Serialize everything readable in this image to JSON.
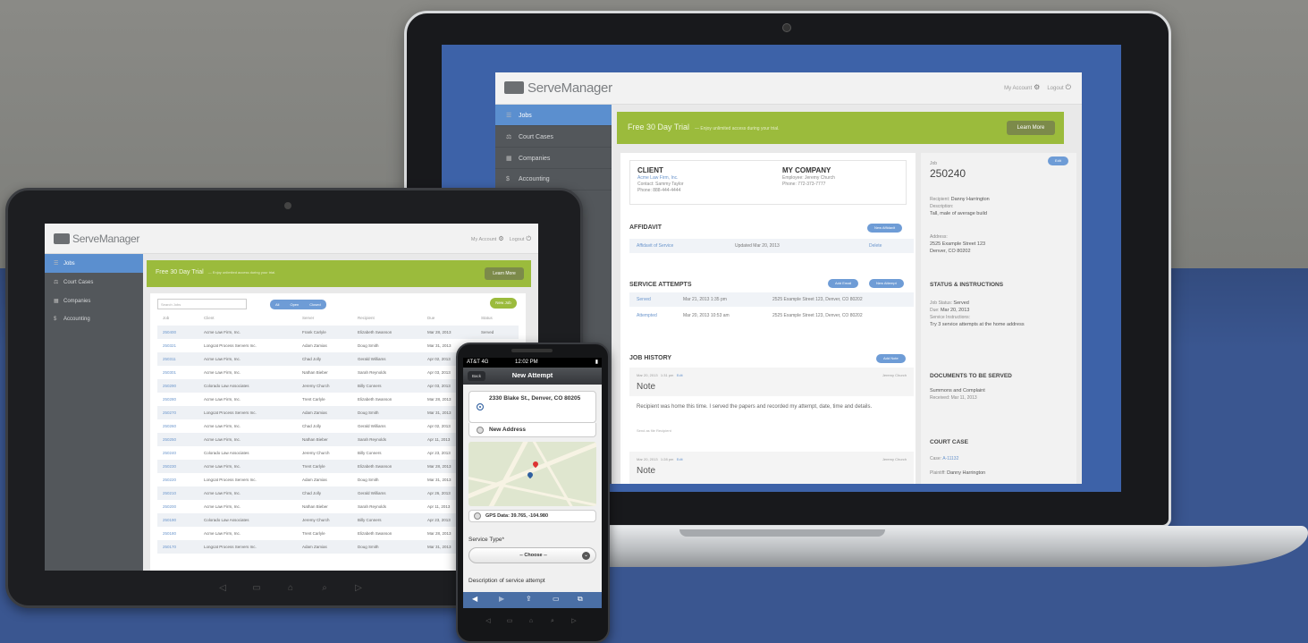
{
  "colors": {
    "accent_blue": "#5b8fcf",
    "trial_green": "#9bbb3c",
    "sidebar": "#53575b",
    "background_blue": "#3a5690"
  },
  "laptop": {
    "logo": "ServeManager",
    "topnav": {
      "account": "My Account",
      "logout": "Logout"
    },
    "sidebar": [
      {
        "label": "Jobs",
        "icon": "jobs-icon"
      },
      {
        "label": "Court Cases",
        "icon": "court-icon"
      },
      {
        "label": "Companies",
        "icon": "companies-icon"
      },
      {
        "label": "Accounting",
        "icon": "accounting-icon"
      }
    ],
    "trial": {
      "title": "Free 30 Day Trial",
      "subtitle": "— Enjoy unlimited access during your trial.",
      "button": "Learn More"
    },
    "client": {
      "heading": "CLIENT",
      "name": "Acme Law Firm, Inc.",
      "contact": "Contact: Sammy Taylor",
      "phone": "Phone: 888-444-4444"
    },
    "company": {
      "heading": "MY COMPANY",
      "employee": "Employee: Jeremy Church",
      "phone": "Phone: 772-373-7777"
    },
    "affidavit": {
      "heading": "AFFIDAVIT",
      "button": "New Affidavit",
      "link": "Affidavit of Service",
      "updated": "Updated Mar 20, 2013",
      "action": "Delete"
    },
    "attempts": {
      "heading": "SERVICE ATTEMPTS",
      "buttons": [
        "Add Email",
        "New Attempt"
      ],
      "rows": [
        {
          "status": "Served",
          "date": "Mar 21, 2013 1:35 pm",
          "address": "2525 Example Street 123, Denver, CO 80202"
        },
        {
          "status": "Attempted",
          "date": "Mar 20, 2013 10:53 am",
          "address": "2525 Example Street 123, Denver, CO 80202"
        }
      ]
    },
    "history": {
      "heading": "JOB HISTORY",
      "button": "Add Note",
      "items": [
        {
          "date": "Mar 20, 2013",
          "time": "1:31 pm",
          "edit": "Edit",
          "author": "Jeremy Church",
          "type": "Note",
          "body": "Recipient was home this time. I served the papers and recorded my attempt, date, time and details.",
          "footer": "Send as file Recipient"
        },
        {
          "date": "Mar 20, 2013",
          "time": "1:28 pm",
          "edit": "Edit",
          "author": "Jeremy Church",
          "type": "Note"
        }
      ]
    },
    "job": {
      "label": "Job",
      "number": "250240",
      "edit": "Edit",
      "recipient_label": "Recipient:",
      "recipient": "Danny Harrington",
      "description_label": "Description:",
      "description": "Tall, male of average build",
      "address_label": "Address:",
      "address_line1": "2525 Example Street 123",
      "address_line2": "Denver, CO 80202",
      "status_heading": "STATUS & INSTRUCTIONS",
      "job_status_label": "Job Status:",
      "job_status": "Served",
      "due_label": "Due:",
      "due": "Mar 20, 2013",
      "instructions_label": "Service Instructions:",
      "instructions": "Try 3 service attempts at the home address",
      "documents_heading": "DOCUMENTS TO BE SERVED",
      "document": "Summons and Complaint",
      "received": "Received: Mar 11, 2013",
      "court_heading": "COURT CASE",
      "case_label": "Case:",
      "case_id": "A-11132",
      "plaintiff_label": "Plaintiff:",
      "plaintiff": "Danny Harrington"
    }
  },
  "tablet": {
    "logo": "ServeManager",
    "topnav": {
      "account": "My Account",
      "logout": "Logout"
    },
    "sidebar": [
      "Jobs",
      "Court Cases",
      "Companies",
      "Accounting"
    ],
    "trial": {
      "title": "Free 30 Day Trial",
      "subtitle": "— Enjoy unlimited access during your trial.",
      "button": "Learn More"
    },
    "search_placeholder": "Search Jobs",
    "filters": [
      "All",
      "Open",
      "Closed"
    ],
    "new_button": "New Job",
    "columns": [
      "Job",
      "Client",
      "Server",
      "Recipient",
      "Due",
      "Status"
    ],
    "rows": [
      [
        "250400",
        "Acme Law Firm, Inc.",
        "Frank Carlyle",
        "Elizabeth Swanson",
        "Mar 28, 2013",
        "Served"
      ],
      [
        "250321",
        "Longcat Process Servers Inc.",
        "Adam Zamias",
        "Doug Smith",
        "Mar 31, 2013",
        ""
      ],
      [
        "250311",
        "Acme Law Firm, Inc.",
        "Chad Jolly",
        "Gerald Williams",
        "Apr 02, 2013",
        ""
      ],
      [
        "250301",
        "Acme Law Firm, Inc.",
        "Nathan Bieber",
        "Sarah Reynolds",
        "Apr 03, 2013",
        ""
      ],
      [
        "250290",
        "Colorado Law Associates",
        "Jeremy Church",
        "Billy Conners",
        "Apr 03, 2013",
        ""
      ],
      [
        "250280",
        "Acme Law Firm, Inc.",
        "Trent Carlyle",
        "Elizabeth Swanson",
        "Mar 28, 2013",
        ""
      ],
      [
        "250270",
        "Longcat Process Servers Inc.",
        "Adam Zamias",
        "Doug Smith",
        "Mar 31, 2013",
        ""
      ],
      [
        "250260",
        "Acme Law Firm, Inc.",
        "Chad Jolly",
        "Gerald Williams",
        "Apr 02, 2013",
        ""
      ],
      [
        "250250",
        "Acme Law Firm, Inc.",
        "Nathan Bieber",
        "Sarah Reynolds",
        "Apr 11, 2013",
        ""
      ],
      [
        "250240",
        "Colorado Law Associates",
        "Jeremy Church",
        "Billy Conners",
        "Apr 23, 2013",
        ""
      ],
      [
        "250230",
        "Acme Law Firm, Inc.",
        "Trent Carlyle",
        "Elizabeth Swanson",
        "Mar 28, 2013",
        ""
      ],
      [
        "250220",
        "Longcat Process Servers Inc.",
        "Adam Zamias",
        "Doug Smith",
        "Mar 31, 2013",
        ""
      ],
      [
        "250210",
        "Acme Law Firm, Inc.",
        "Chad Jolly",
        "Gerald Williams",
        "Apr 26, 2013",
        ""
      ],
      [
        "250200",
        "Acme Law Firm, Inc.",
        "Nathan Bieber",
        "Sarah Reynolds",
        "Apr 11, 2013",
        ""
      ],
      [
        "250190",
        "Colorado Law Associates",
        "Jeremy Church",
        "Billy Conners",
        "Apr 23, 2013",
        ""
      ],
      [
        "250180",
        "Acme Law Firm, Inc.",
        "Trent Carlyle",
        "Elizabeth Swanson",
        "Mar 28, 2013",
        ""
      ],
      [
        "250170",
        "Longcat Process Servers Inc.",
        "Adam Zamias",
        "Doug Smith",
        "Mar 31, 2013",
        ""
      ]
    ]
  },
  "phone": {
    "carrier": "AT&T 4G",
    "time": "12:02 PM",
    "back": "Back",
    "title": "New Attempt",
    "address_option": "2330 Blake St., Denver, CO 80205",
    "new_address": "New Address",
    "gps": "GPS Data: 39.765, -104.980",
    "service_type_label": "Service Type*",
    "service_type_value": "-- Choose --",
    "description_label": "Description of service attempt"
  }
}
